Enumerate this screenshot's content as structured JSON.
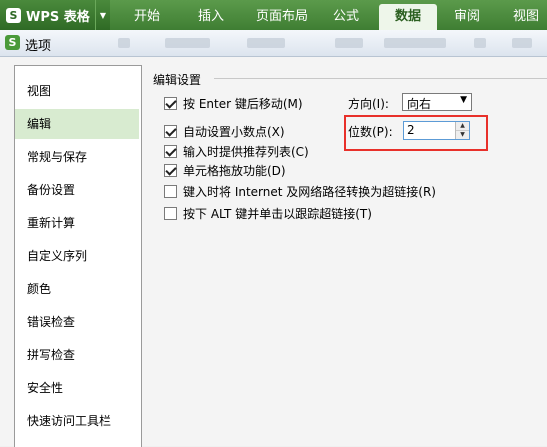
{
  "app": {
    "logo_badge": "S",
    "logo_name": "WPS 表格"
  },
  "ribbon_tabs": [
    "开始",
    "插入",
    "页面布局",
    "公式",
    "数据",
    "审阅",
    "视图"
  ],
  "active_tab": "数据",
  "dialog": {
    "icon_badge": "S",
    "title": "选项"
  },
  "sidebar": [
    "视图",
    "编辑",
    "常规与保存",
    "备份设置",
    "重新计算",
    "自定义序列",
    "颜色",
    "错误检查",
    "拼写检查",
    "安全性",
    "快速访问工具栏"
  ],
  "selected_sidebar": "编辑",
  "edit_settings": {
    "group_title": "编辑设置",
    "options": [
      {
        "label": "按 Enter 键后移动(M)",
        "checked": true
      },
      {
        "label": "自动设置小数点(X)",
        "checked": true
      },
      {
        "label": "输入时提供推荐列表(C)",
        "checked": true
      },
      {
        "label": "单元格拖放功能(D)",
        "checked": true
      },
      {
        "label": "键入时将 Internet 及网络路径转换为超链接(R)",
        "checked": false
      },
      {
        "label": "按下 ALT 键并单击以跟踪超链接(T)",
        "checked": false
      }
    ],
    "direction_label": "方向(I):",
    "direction_value": "向右",
    "decimal_label": "位数(P):",
    "decimal_value": "2"
  },
  "colors": {
    "ribbon_green": "#4a8a3c",
    "selected_bg": "#d8ebd0",
    "highlight_red": "#e8302a"
  }
}
